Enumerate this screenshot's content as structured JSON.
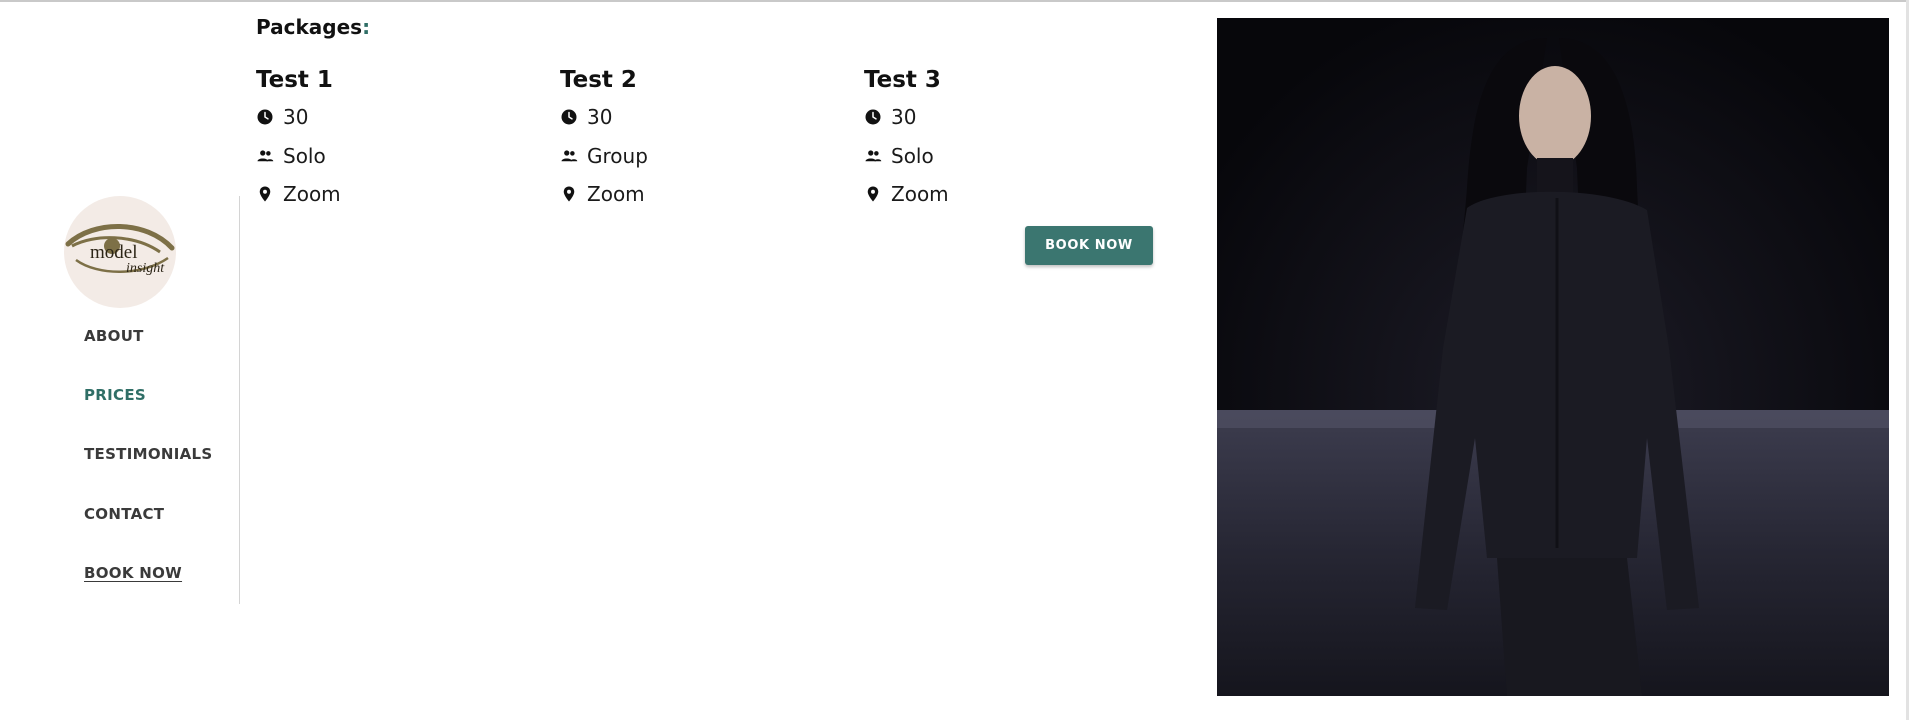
{
  "brand": {
    "logo_icon": "eye-logo-icon",
    "logo_text_main": "model",
    "logo_text_sub": "insight",
    "logo_bg": "#f3ebe6",
    "logo_color": "#7d7047"
  },
  "sidebar": {
    "items": [
      {
        "label": "ABOUT",
        "active": false
      },
      {
        "label": "PRICES",
        "active": true
      },
      {
        "label": "TESTIMONIALS",
        "active": false
      },
      {
        "label": "CONTACT",
        "active": false
      },
      {
        "label": "BOOK NOW",
        "active": false
      }
    ]
  },
  "packages": {
    "title": "Packages",
    "title_suffix": ":",
    "items": [
      {
        "name": "Test 1",
        "duration": "30",
        "type": "Solo",
        "location": "Zoom"
      },
      {
        "name": "Test 2",
        "duration": "30",
        "type": "Group",
        "location": "Zoom"
      },
      {
        "name": "Test 3",
        "duration": "30",
        "type": "Solo",
        "location": "Zoom"
      }
    ],
    "icons": {
      "duration": "clock-icon",
      "type": "people-icon",
      "location": "location-pin-icon"
    },
    "book_label": "BOOK NOW"
  },
  "photo": {
    "subject": "runway-model-photo"
  },
  "colors": {
    "accent": "#2f6e66",
    "button": "#3b7670",
    "nav_text": "#3a3a3a"
  }
}
